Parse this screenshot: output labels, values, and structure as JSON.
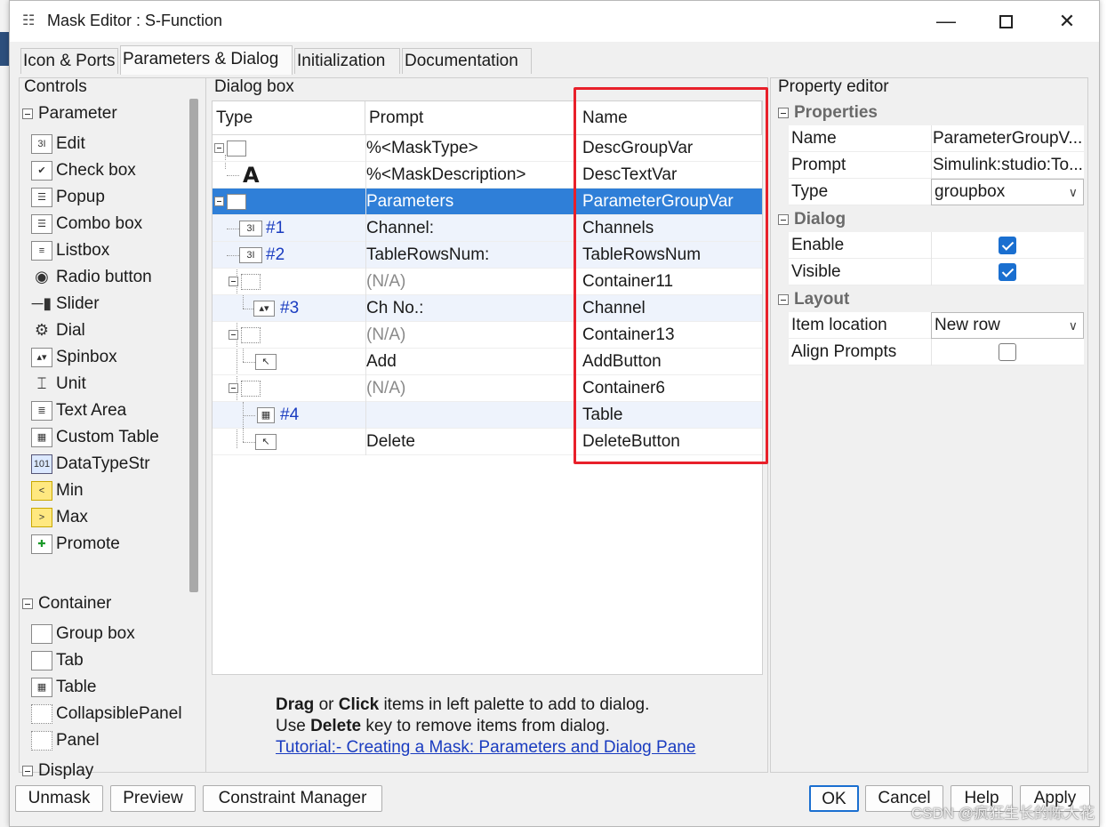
{
  "window": {
    "title": "Mask Editor : S-Function"
  },
  "tabs": [
    "Icon & Ports",
    "Parameters & Dialog",
    "Initialization",
    "Documentation"
  ],
  "controls": {
    "title": "Controls",
    "parameter_section": "Parameter",
    "parameter_items": [
      {
        "label": "Edit",
        "icon": "edit-icon"
      },
      {
        "label": "Check box",
        "icon": "checkbox-icon"
      },
      {
        "label": "Popup",
        "icon": "popup-icon"
      },
      {
        "label": "Combo box",
        "icon": "combobox-icon"
      },
      {
        "label": "Listbox",
        "icon": "listbox-icon"
      },
      {
        "label": "Radio button",
        "icon": "radio-button-icon"
      },
      {
        "label": "Slider",
        "icon": "slider-icon"
      },
      {
        "label": "Dial",
        "icon": "dial-icon"
      },
      {
        "label": "Spinbox",
        "icon": "spinbox-icon"
      },
      {
        "label": "Unit",
        "icon": "unit-icon"
      },
      {
        "label": "Text Area",
        "icon": "text-area-icon"
      },
      {
        "label": "Custom Table",
        "icon": "custom-table-icon"
      },
      {
        "label": "DataTypeStr",
        "icon": "datatypestr-icon"
      },
      {
        "label": "Min",
        "icon": "min-icon"
      },
      {
        "label": "Max",
        "icon": "max-icon"
      },
      {
        "label": "Promote",
        "icon": "promote-icon"
      }
    ],
    "container_section": "Container",
    "container_items": [
      {
        "label": "Group box",
        "icon": "group-box-icon"
      },
      {
        "label": "Tab",
        "icon": "tab-icon"
      },
      {
        "label": "Table",
        "icon": "table-icon"
      },
      {
        "label": "CollapsiblePanel",
        "icon": "collapsible-panel-icon"
      },
      {
        "label": "Panel",
        "icon": "panel-icon"
      }
    ],
    "display_section": "Display"
  },
  "dialog": {
    "title": "Dialog box",
    "columns": {
      "type": "Type",
      "prompt": "Prompt",
      "name": "Name"
    },
    "rows": [
      {
        "index": "",
        "prompt": "%<MaskType>",
        "name": "DescGroupVar"
      },
      {
        "index": "",
        "prompt": "%<MaskDescription>",
        "name": "DescTextVar"
      },
      {
        "index": "",
        "prompt": "Parameters",
        "name": "ParameterGroupVar"
      },
      {
        "index": "#1",
        "prompt": "Channel:",
        "name": "Channels"
      },
      {
        "index": "#2",
        "prompt": "TableRowsNum:",
        "name": "TableRowsNum"
      },
      {
        "index": "",
        "prompt": "(N/A)",
        "name": "Container11"
      },
      {
        "index": "#3",
        "prompt": "Ch No.:",
        "name": "Channel"
      },
      {
        "index": "",
        "prompt": "(N/A)",
        "name": "Container13"
      },
      {
        "index": "",
        "prompt": "Add",
        "name": "AddButton"
      },
      {
        "index": "",
        "prompt": "(N/A)",
        "name": "Container6"
      },
      {
        "index": "#4",
        "prompt": "",
        "name": "Table"
      },
      {
        "index": "",
        "prompt": "Delete",
        "name": "DeleteButton"
      }
    ],
    "hint": {
      "drag": "Drag",
      "or": " or ",
      "click": "Click",
      "line1_rest": " items in left palette to add to dialog.",
      "use": "Use ",
      "delete": "Delete",
      "line2_rest": " key to remove items from dialog.",
      "link": "Tutorial:- Creating a Mask: Parameters and Dialog Pane"
    }
  },
  "property_editor": {
    "title": "Property editor",
    "properties_section": "Properties",
    "name_label": "Name",
    "name_value": "ParameterGroupV...",
    "prompt_label": "Prompt",
    "prompt_value": "Simulink:studio:To...",
    "type_label": "Type",
    "type_value": "groupbox",
    "dialog_section": "Dialog",
    "enable_label": "Enable",
    "visible_label": "Visible",
    "layout_section": "Layout",
    "location_label": "Item location",
    "location_value": "New row",
    "align_label": "Align Prompts"
  },
  "buttons": {
    "unmask": "Unmask",
    "preview": "Preview",
    "constraint": "Constraint Manager",
    "ok": "OK",
    "cancel": "Cancel",
    "help": "Help",
    "apply": "Apply"
  },
  "watermark": "CSDN @疯狂生长的陈大花"
}
